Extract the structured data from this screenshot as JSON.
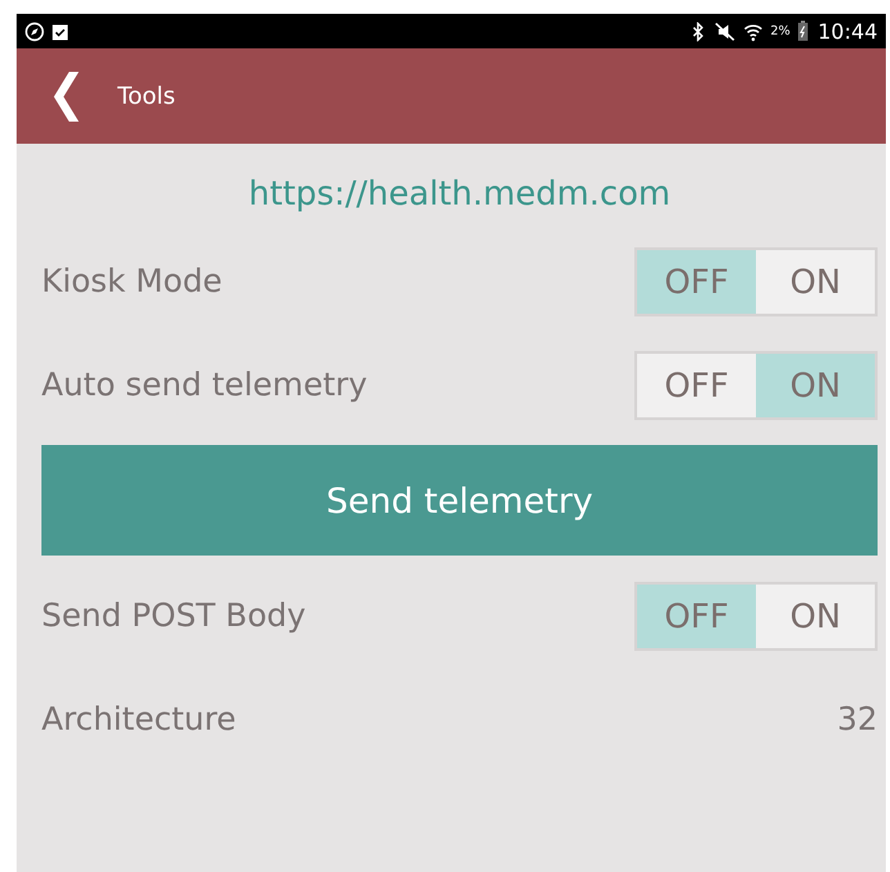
{
  "status_bar": {
    "battery": "2%",
    "time": "10:44"
  },
  "app_bar": {
    "title": "Tools"
  },
  "url": "https://health.medm.com",
  "rows": [
    {
      "kind": "toggle",
      "label": "Kiosk Mode",
      "options": [
        {
          "label": "OFF",
          "selected": true
        },
        {
          "label": "ON",
          "selected": false
        }
      ]
    },
    {
      "kind": "toggle",
      "label": "Auto send telemetry",
      "options": [
        {
          "label": "OFF",
          "selected": false
        },
        {
          "label": "ON",
          "selected": true
        }
      ]
    },
    {
      "kind": "button",
      "label": "Send telemetry"
    },
    {
      "kind": "toggle",
      "label": "Send POST Body",
      "options": [
        {
          "label": "OFF",
          "selected": true
        },
        {
          "label": "ON",
          "selected": false
        }
      ]
    },
    {
      "kind": "value",
      "label": "Architecture",
      "value": "32"
    }
  ]
}
